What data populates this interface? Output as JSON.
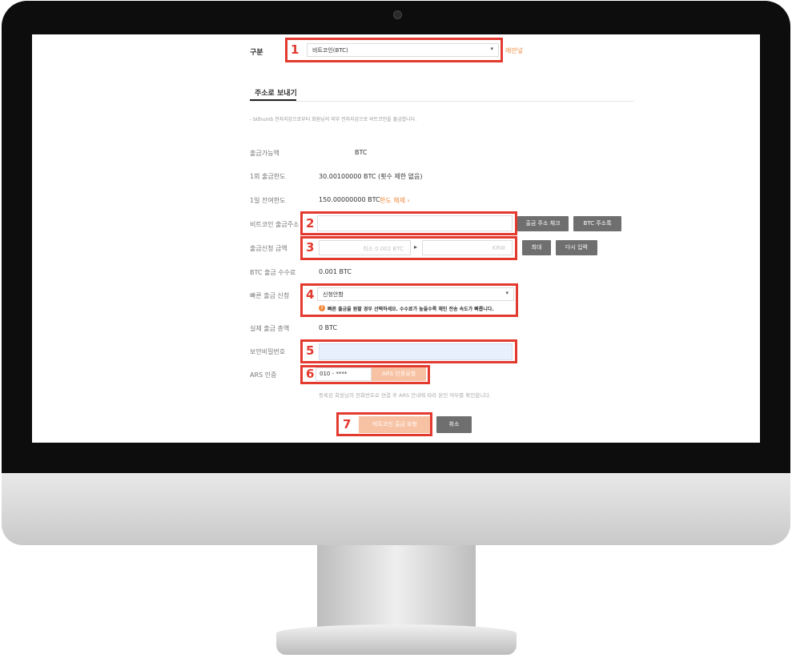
{
  "form": {
    "category_label": "구분",
    "coin_select_value": "비트코인(BTC)",
    "coin_select_suffix": "에안넣",
    "tab_send_by_address": "주소로 보내기",
    "notice": "- bithumb 전자지갑으로부터 회원님의 외부 전자지갑으로 비트코인을 출금합니다.",
    "available_label": "출금가능액",
    "available_value": "BTC",
    "single_limit_label": "1회 출금한도",
    "single_limit_value": "30.00100000 BTC (횟수 제한 없음)",
    "daily_remaining_label": "1일 잔여한도",
    "daily_remaining_value": "150.00000000 BTC",
    "daily_remaining_link": "한도 해제 ›",
    "address_label": "비트코인 출금주소",
    "address_value": "",
    "check_address_button": "출금 주소 체크",
    "btc_address_book_button": "BTC 주소록",
    "amount_label": "출금신청 금액",
    "amount_btc_placeholder": "최소 0.002 BTC",
    "amount_krw_placeholder": "KRW",
    "max_button": "최대",
    "reenter_button": "다시 입력",
    "fee_label": "BTC 출금 수수료",
    "fee_value": "0.001 BTC",
    "fast_withdraw_label": "빠른 출금 신청",
    "fast_withdraw_value": "신청안함",
    "fast_withdraw_warning": "빠른 출금을 원할 경우 선택하세요. 수수료가 높을수록 체인 전송 속도가 빠릅니다.",
    "actual_amount_label": "실제 출금 총액",
    "actual_amount_value": "0 BTC",
    "security_pw_label": "보안비밀번호",
    "security_pw_value": "",
    "ars_label": "ARS 인증",
    "ars_phone_value": "010 - ****",
    "ars_request_button": "ARS 인증요청",
    "ars_notice": "등록된 회원님의 전화번호로 연결 후 ARS 안내에 따라 본인 여부를 확인합니다.",
    "submit_button": "비트코인 출금 요청",
    "cancel_button": "취소"
  },
  "steps": [
    "1",
    "2",
    "3",
    "4",
    "5",
    "6",
    "7"
  ],
  "colors": {
    "accent_orange": "#f08a3e",
    "button_gray": "#6f6f6f",
    "highlight_red": "#e33a2f",
    "security_field_bg": "#e8f0fe"
  }
}
